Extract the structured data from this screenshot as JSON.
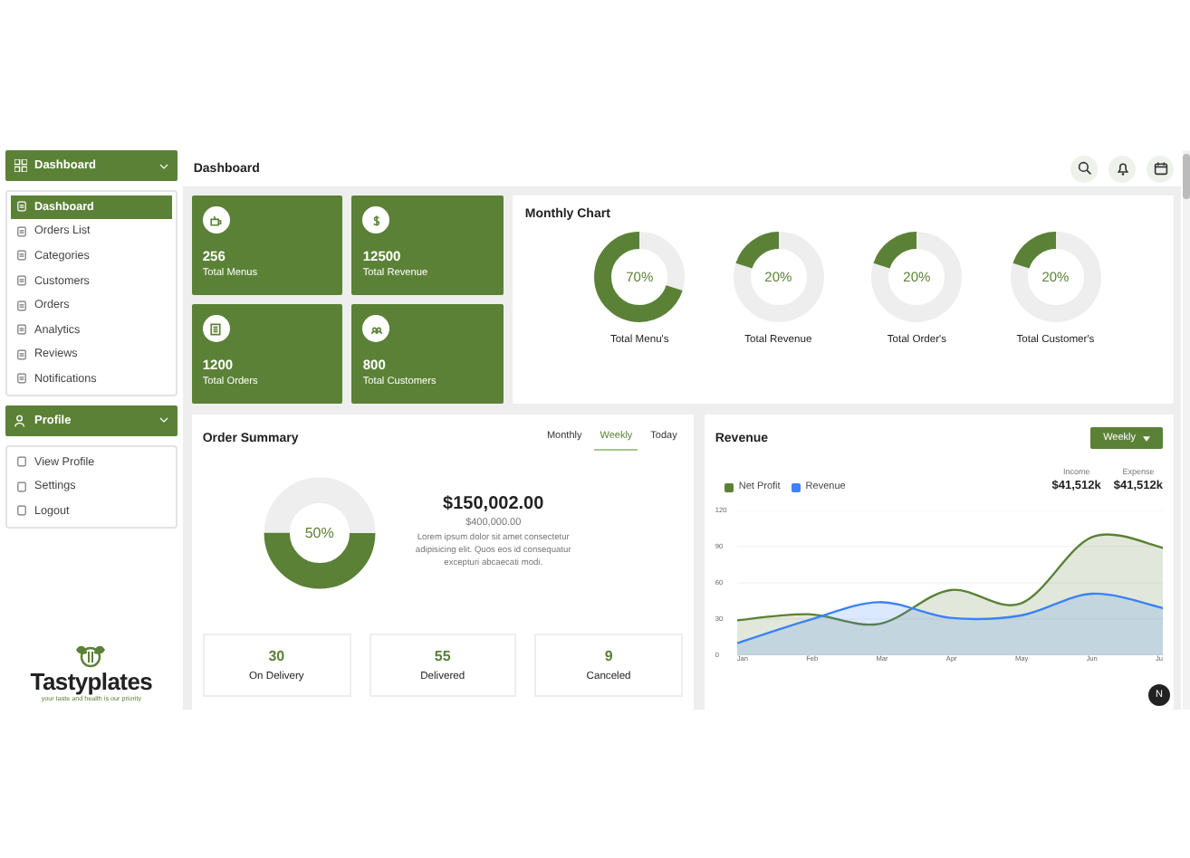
{
  "sidebar": {
    "header": {
      "label": "Dashboard",
      "expanded": true
    },
    "items": [
      {
        "label": "Dashboard",
        "selected": true
      },
      {
        "label": "Orders List",
        "selected": false
      },
      {
        "label": "Categories",
        "selected": false
      },
      {
        "label": "Customers",
        "selected": false
      },
      {
        "label": "Orders",
        "selected": false
      },
      {
        "label": "Analytics",
        "selected": false
      },
      {
        "label": "Reviews",
        "selected": false
      },
      {
        "label": "Notifications",
        "selected": false
      }
    ],
    "profile_header": {
      "label": "Profile",
      "expanded": true
    },
    "profile_items": [
      {
        "label": "View Profile"
      },
      {
        "label": "Settings"
      },
      {
        "label": "Logout"
      }
    ],
    "logo": {
      "name": "Tastyplates",
      "tagline": "your taste and health is our priority"
    }
  },
  "header": {
    "title": "Dashboard"
  },
  "stats": [
    {
      "kind": "menus",
      "value": "256",
      "label": "Total Menus"
    },
    {
      "kind": "revenue",
      "value": "12500",
      "label": "Total Revenue"
    },
    {
      "kind": "orders",
      "value": "1200",
      "label": "Total Orders"
    },
    {
      "kind": "customers",
      "value": "800",
      "label": "Total Customers"
    }
  ],
  "monthly_chart": {
    "title": "Monthly Chart",
    "donuts": [
      {
        "reading": "70%",
        "level": 0.7,
        "label": "Total Menu's"
      },
      {
        "reading": "20%",
        "level": 0.2,
        "label": "Total Revenue"
      },
      {
        "reading": "20%",
        "level": 0.2,
        "label": "Total Order's"
      },
      {
        "reading": "20%",
        "level": 0.2,
        "label": "Total Customer's"
      }
    ]
  },
  "order_summary": {
    "title": "Order Summary",
    "tabs": [
      {
        "label": "Monthly",
        "selected": false
      },
      {
        "label": "Weekly",
        "selected": true
      },
      {
        "label": "Today",
        "selected": false
      }
    ],
    "donut": {
      "reading": "50%",
      "level": 0.5
    },
    "amount": "$150,002.00",
    "target": "$400,000.00",
    "description": "Lorem ipsum dolor sit amet consectetur adipisicing elit. Quos eos id consequatur excepturi abcaecati modi.",
    "counts": [
      {
        "value": "30",
        "label": "On Delivery"
      },
      {
        "value": "55",
        "label": "Delivered"
      },
      {
        "value": "9",
        "label": "Canceled"
      }
    ]
  },
  "revenue": {
    "title": "Revenue",
    "period": "Weekly",
    "totals": [
      {
        "label": "Income",
        "value": "$41,512k"
      },
      {
        "label": "Expense",
        "value": "$41,512k"
      }
    ],
    "chart_data": {
      "type": "area",
      "grid": true,
      "categories": [
        "Jan",
        "Feb",
        "Mar",
        "Apr",
        "May",
        "Jun",
        "Ju"
      ],
      "yticks": [
        0,
        30,
        60,
        90,
        120
      ],
      "ylim": [
        0,
        120
      ],
      "series": [
        {
          "name": "Net Profit",
          "color": "#5b8136",
          "values": [
            29,
            34,
            26,
            54,
            43,
            98,
            89
          ]
        },
        {
          "name": "Revenue",
          "color": "#3b82f6",
          "values": [
            10,
            29,
            44,
            31,
            33,
            51,
            39
          ]
        }
      ]
    }
  },
  "floating_badge": "N"
}
